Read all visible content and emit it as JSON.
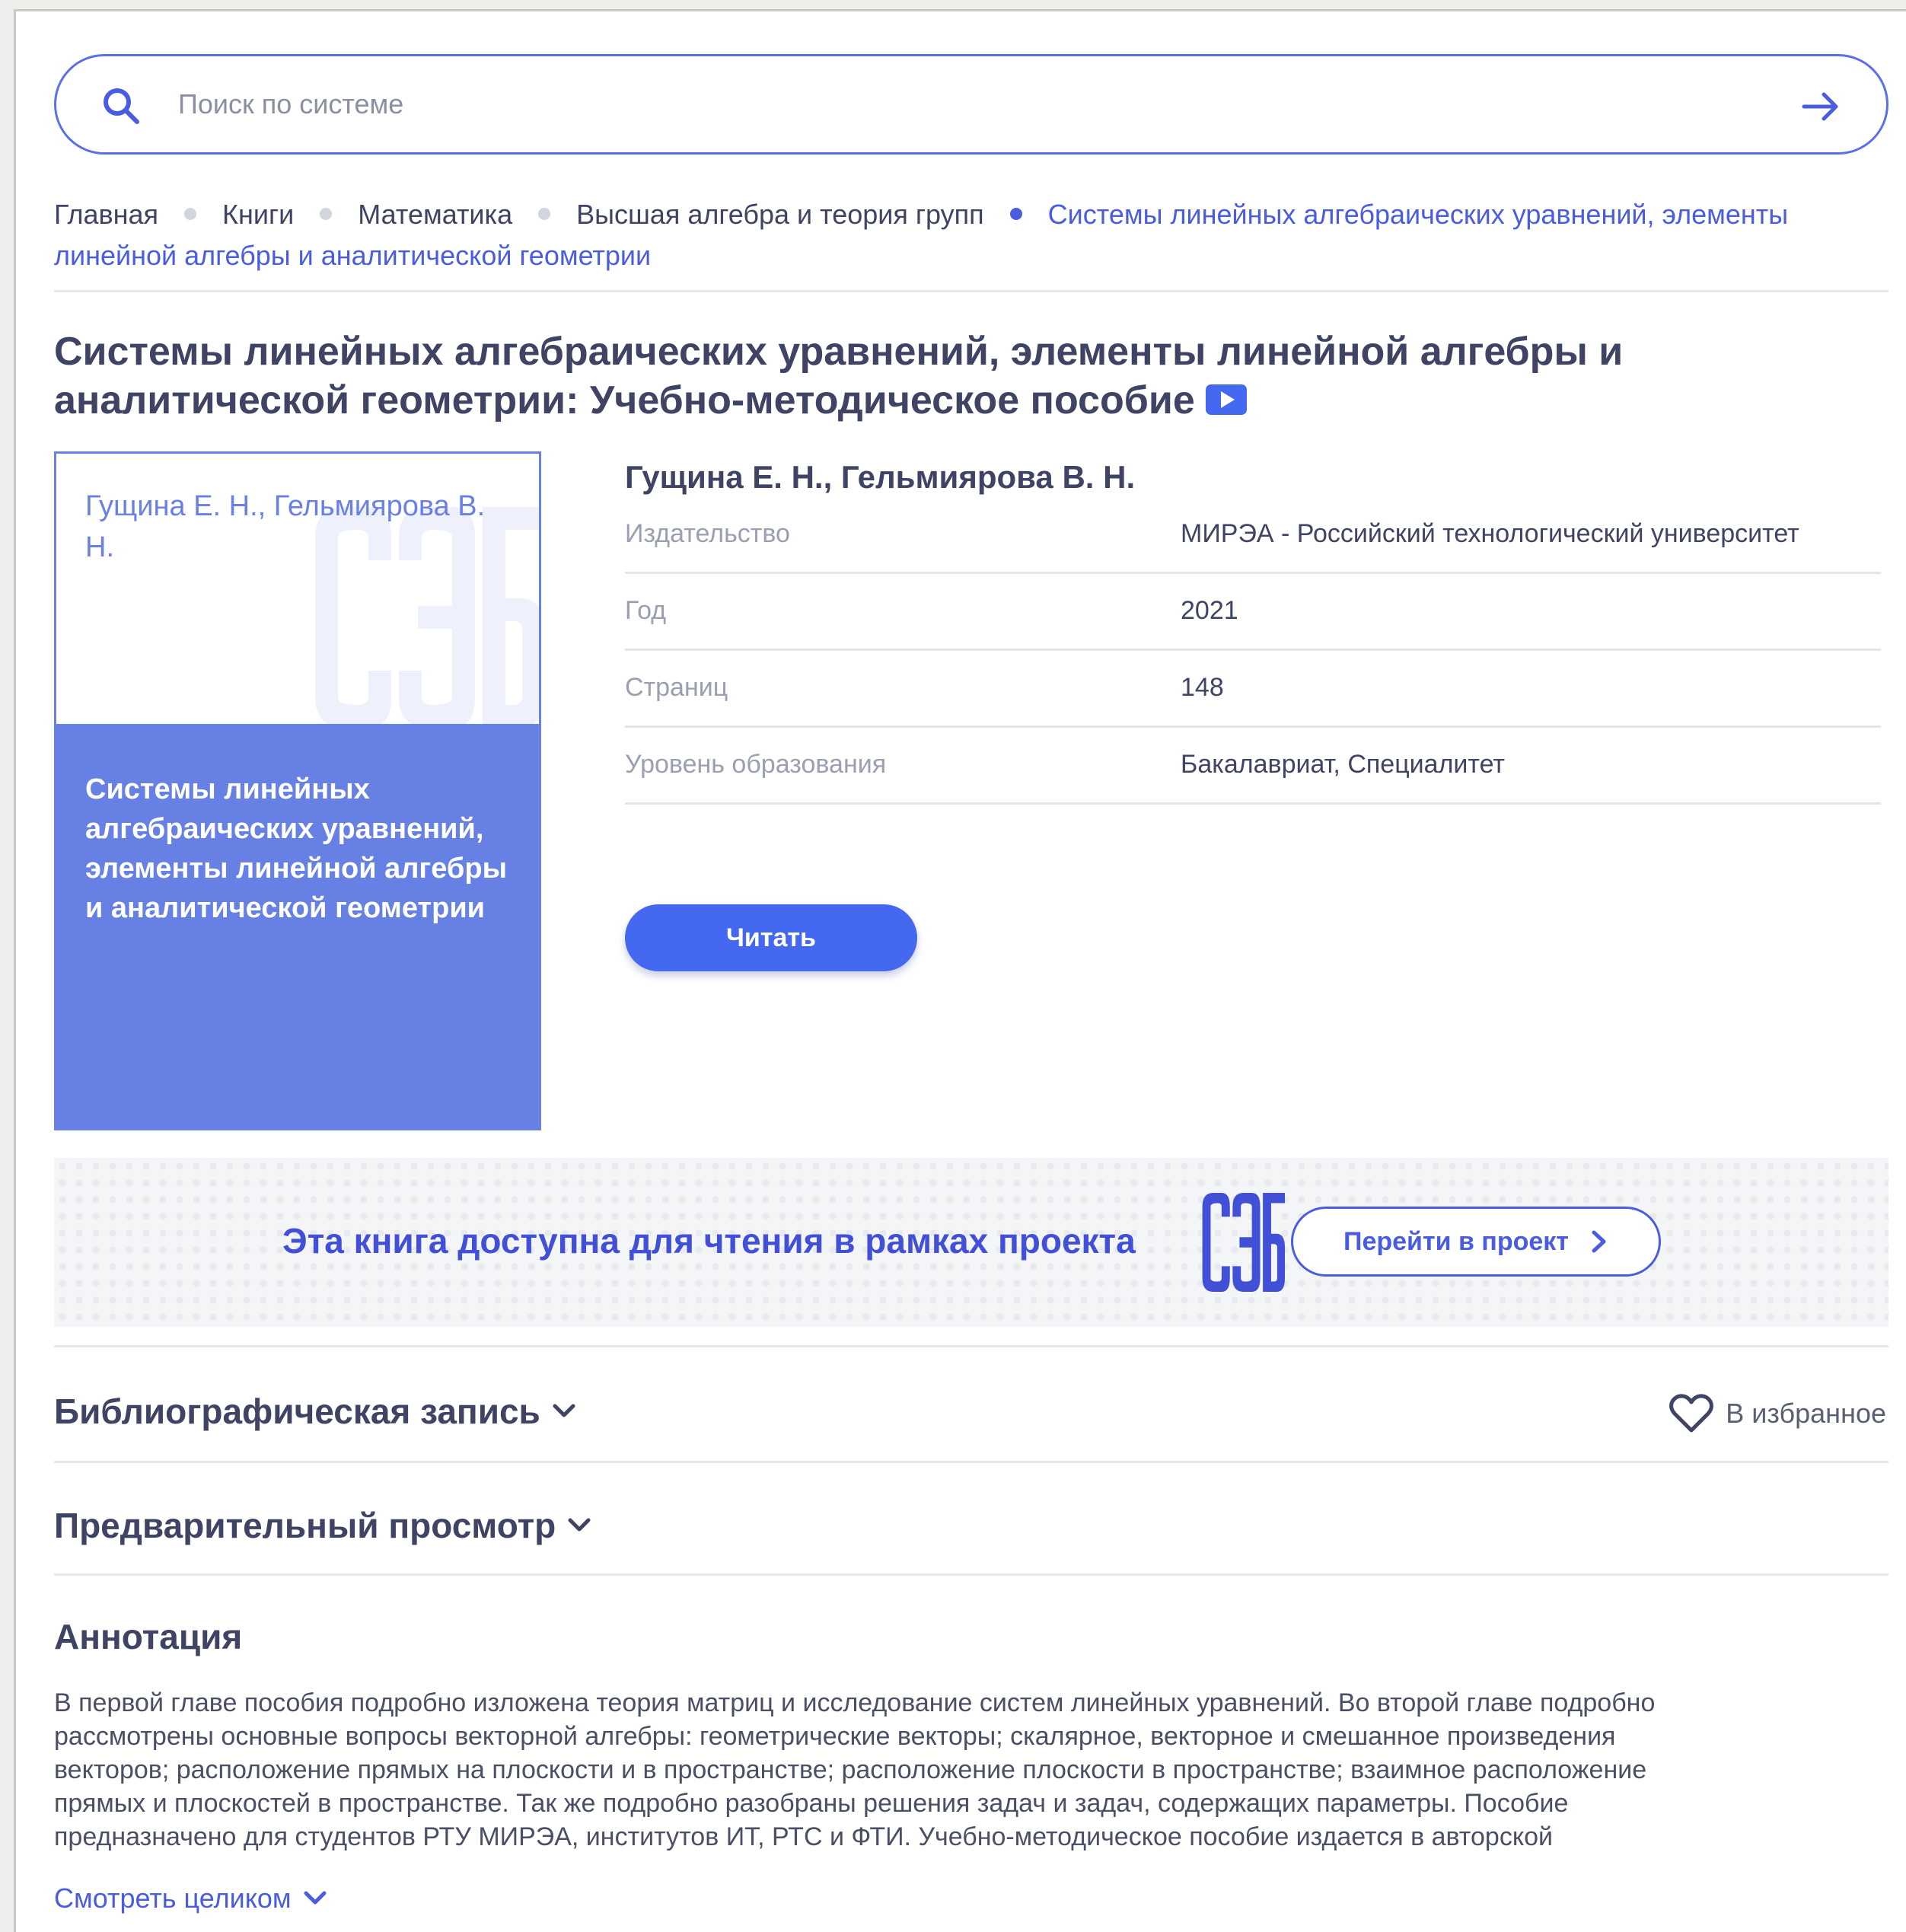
{
  "search": {
    "placeholder": "Поиск по системе"
  },
  "breadcrumb": {
    "items": [
      "Главная",
      "Книги",
      "Математика",
      "Высшая алгебра и теория групп"
    ],
    "current": "Системы линейных алгебраических уравнений, элементы линейной алгебры и аналитической геометрии"
  },
  "book": {
    "title": "Системы линейных алгебраических уравнений, элементы линейной алгебры и аналитической геометрии: Учебно-методическое пособие",
    "authors": "Гущина Е. Н., Гельмиярова В. Н.",
    "cover": {
      "author": "Гущина Е. Н., Гельмиярова В. Н.",
      "title": "Системы линейных алгебраических уравнений, элементы линейной алгебры и аналитической геометрии"
    },
    "details": [
      {
        "key": "Издательство",
        "value": "МИРЭА - Российский технологический университет"
      },
      {
        "key": "Год",
        "value": "2021"
      },
      {
        "key": "Страниц",
        "value": "148"
      },
      {
        "key": "Уровень образования",
        "value": "Бакалавриат, Специалитет"
      }
    ],
    "read_label": "Читать"
  },
  "banner": {
    "text": "Эта книга доступна для чтения в рамках проекта",
    "button": "Перейти в проект"
  },
  "sections": {
    "bibliography": "Библиографическая запись",
    "preview": "Предварительный просмотр",
    "annotation": "Аннотация",
    "favorite": "В избранное"
  },
  "annotation": {
    "lines": [
      "В первой главе пособия подробно изложена теория матриц и исследование систем линейных уравнений. Во второй главе подробно",
      "рассмотрены основные вопросы векторной алгебры: геометрические векторы; скалярное, векторное и смешанное произведения",
      "векторов; расположение прямых на плоскости и в пространстве; расположение плоскости в пространстве; взаимное расположение",
      "прямых и плоскостей в пространстве. Так же подробно разобраны решения задач и задач, содержащих параметры. Пособие",
      "предназначено для студентов РТУ МИРЭА, институтов ИТ, РТС и ФТИ. Учебно-методическое пособие издается в авторской"
    ],
    "more": "Смотреть целиком"
  },
  "colors": {
    "accent": "#4a5de0",
    "button": "#4468f0",
    "cover": "#6780e4"
  }
}
